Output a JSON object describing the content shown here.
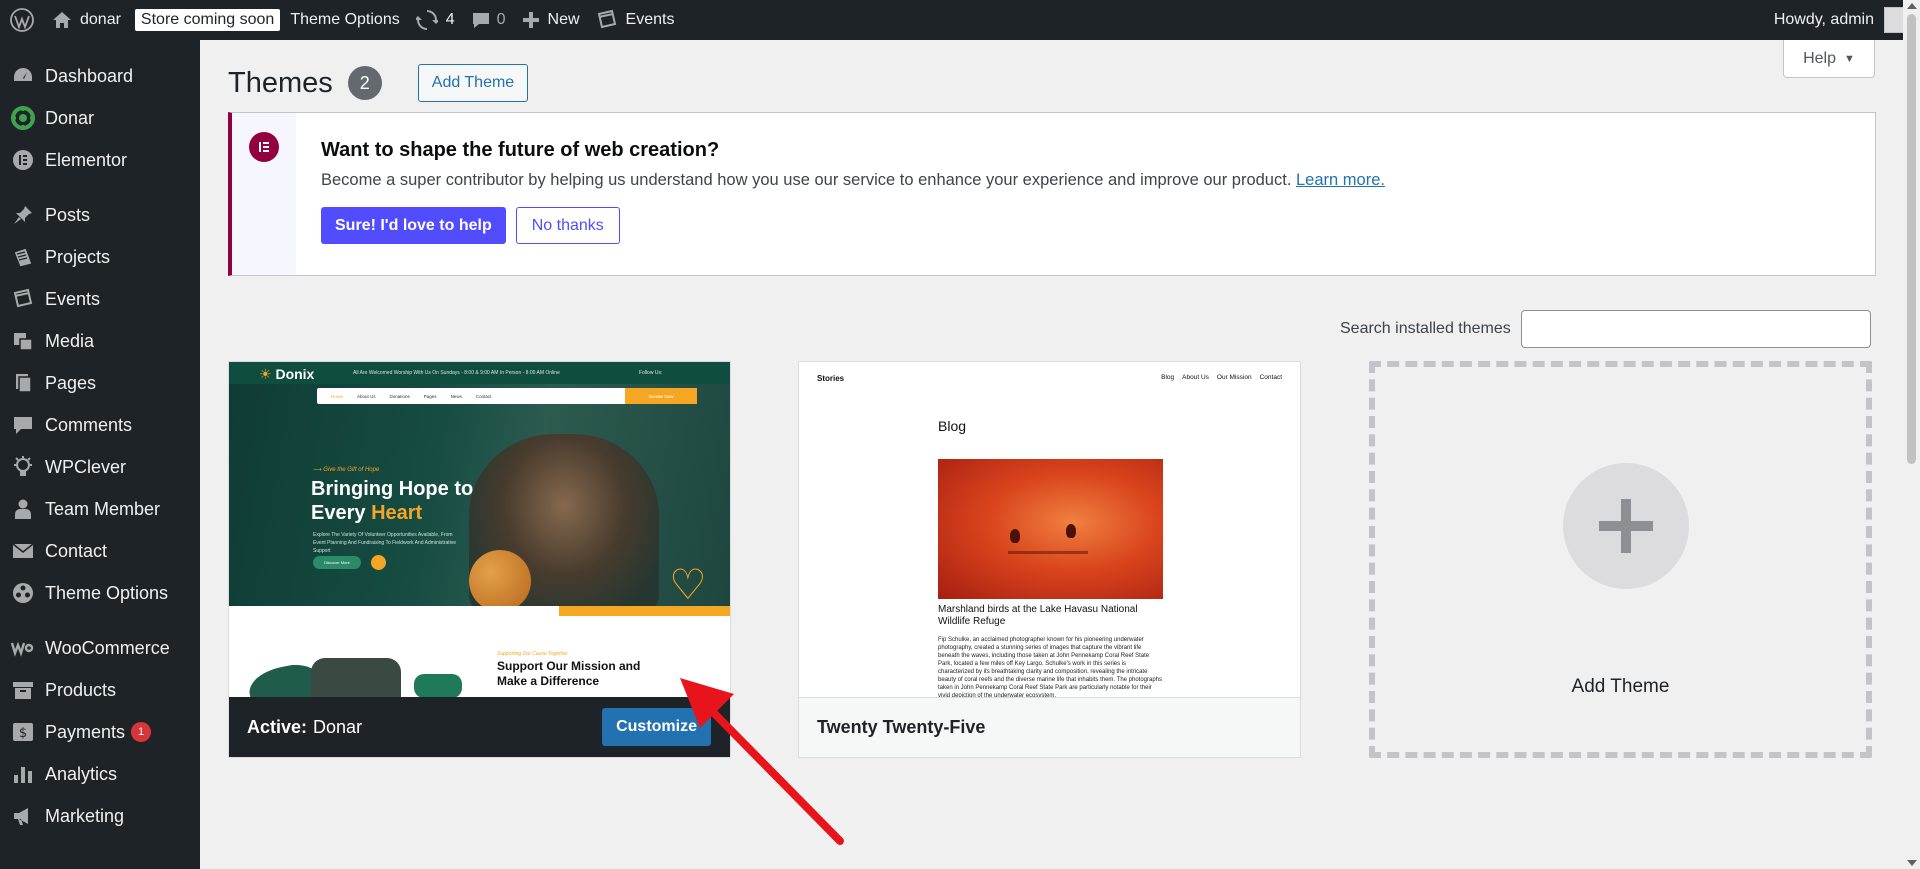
{
  "adminbar": {
    "site_name": "donar",
    "store_badge": "Store coming soon",
    "theme_options": "Theme Options",
    "updates_count": "4",
    "comments_count": "0",
    "new_label": "New",
    "events_label": "Events",
    "howdy": "Howdy, admin"
  },
  "sidebar": {
    "items": [
      {
        "label": "Dashboard",
        "icon": "dashboard-icon"
      },
      {
        "label": "Donar",
        "icon": "donar-icon"
      },
      {
        "label": "Elementor",
        "icon": "elementor-icon"
      },
      {
        "label": "Posts",
        "icon": "pin-icon"
      },
      {
        "label": "Projects",
        "icon": "projects-icon"
      },
      {
        "label": "Events",
        "icon": "events-icon"
      },
      {
        "label": "Media",
        "icon": "media-icon"
      },
      {
        "label": "Pages",
        "icon": "pages-icon"
      },
      {
        "label": "Comments",
        "icon": "comments-icon"
      },
      {
        "label": "WPClever",
        "icon": "wpclever-icon"
      },
      {
        "label": "Team Member",
        "icon": "person-icon"
      },
      {
        "label": "Contact",
        "icon": "mail-icon"
      },
      {
        "label": "Theme Options",
        "icon": "theme-options-icon"
      },
      {
        "label": "WooCommerce",
        "icon": "woocommerce-icon"
      },
      {
        "label": "Products",
        "icon": "archive-icon"
      },
      {
        "label": "Payments",
        "icon": "payments-icon",
        "badge": "1"
      },
      {
        "label": "Analytics",
        "icon": "bar-chart-icon"
      },
      {
        "label": "Marketing",
        "icon": "megaphone-icon"
      }
    ]
  },
  "help": "Help",
  "page": {
    "title": "Themes",
    "count": "2",
    "add_theme": "Add Theme"
  },
  "notice": {
    "title": "Want to shape the future of web creation?",
    "text": "Become a super contributor by helping us understand how you use our service to enhance your experience and improve our product.",
    "link": "Learn more.",
    "primary": "Sure! I'd love to help",
    "secondary": "No thanks"
  },
  "search": {
    "label": "Search installed themes",
    "value": ""
  },
  "themes": [
    {
      "active_prefix": "Active:",
      "name": "Donar",
      "action": "Customize",
      "preview": {
        "logo": "Donix",
        "topbar_info": "All Are Welcomed Worship With Us On Sundays - 8:00 & 9:00 AM In Person - 8:00 AM Online",
        "follow": "Follow Us:",
        "nav": [
          "Home",
          "About Us",
          "Donations",
          "Pages",
          "News",
          "Contact"
        ],
        "nav_cta": "Donate Now",
        "tagline": "Give the Gift of Hope",
        "headline_1": "Bringing Hope to",
        "headline_2a": "Every ",
        "headline_2b": "Heart",
        "sub": "Explore The Variety Of Volunteer Opportunities Available, From Event Planning And Fundraising To Fieldwork And Administrative Support",
        "button": "Discover More",
        "about_tag": "Supporting Our Cause Together",
        "about_heading": "Support Our Mission and Make a Difference"
      }
    },
    {
      "name": "Twenty Twenty-Five",
      "preview": {
        "site": "Stories",
        "nav": [
          "Blog",
          "About Us",
          "Our Mission",
          "Contact"
        ],
        "heading": "Blog",
        "post_title": "Marshland birds at the Lake Havasu National Wildlife Refuge",
        "post_text": "Fip Schulke, an acclaimed photographer known for his pioneering underwater photography, created a stunning series of images that capture the vibrant life beneath the waves, including those taken at John Pennekamp Coral Reef State Park, located a few miles off Key Largo. Schulke's work in this series is characterized by its breathtaking clarity and composition, revealing the intricate beauty of coral reefs and the diverse marine life that inhabits them. The photographs taken in John Pennekamp Coral Reef State Park are particularly notable for their vivid depiction of the underwater ecosystem."
      }
    }
  ],
  "add_card": {
    "label": "Add Theme"
  },
  "colors": {
    "admin_dark": "#1d2327",
    "wp_blue": "#2271b1",
    "elementor_maroon": "#93003f",
    "elementor_purple": "#524cff",
    "annotation_red": "#e8141c"
  }
}
